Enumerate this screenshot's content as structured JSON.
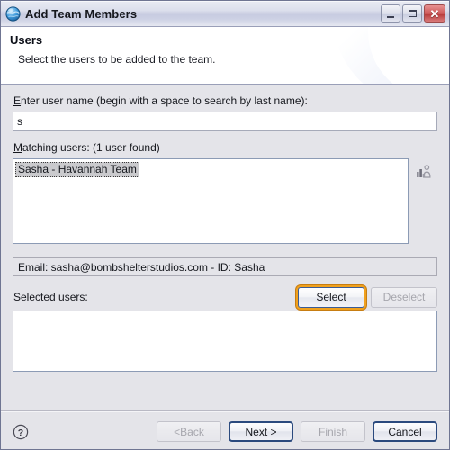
{
  "window": {
    "title": "Add Team Members",
    "icon": "globe-icon",
    "controls": {
      "minimize": "minimize-icon",
      "maximize": "maximize-icon",
      "close": "close-icon",
      "close_glyph": "✕"
    }
  },
  "banner": {
    "title": "Users",
    "subtitle": "Select the users to be added to the team."
  },
  "form": {
    "username_label_pre": "",
    "username_label_mnemonic": "E",
    "username_label_post": "nter user name (begin with a space to search by last name):",
    "username_value": "s",
    "username_placeholder": "",
    "matching_label_mnemonic": "M",
    "matching_label_post": "atching users: (1 user found)",
    "matching_users": [
      "Sasha - Havannah Team"
    ],
    "details_icon": "user-details-icon",
    "status_text": "Email: sasha@bombshelterstudios.com - ID: Sasha",
    "selected_label_pre": "Selected ",
    "selected_label_mnemonic": "u",
    "selected_label_post": "sers:",
    "selected_users": [],
    "select_button": {
      "pre": "",
      "mnemonic": "S",
      "post": "elect",
      "state": "focused-default"
    },
    "deselect_button": {
      "pre": "",
      "mnemonic": "D",
      "post": "eselect",
      "state": "disabled"
    }
  },
  "footer": {
    "help_icon": "help-icon",
    "help_glyph": "?",
    "back_button": {
      "pre": "< ",
      "mnemonic": "B",
      "post": "ack",
      "state": "disabled"
    },
    "next_button": {
      "pre": "",
      "mnemonic": "N",
      "post": "ext >",
      "state": "default"
    },
    "finish_button": {
      "pre": "",
      "mnemonic": "F",
      "post": "inish",
      "state": "disabled"
    },
    "cancel_button": {
      "pre": "",
      "mnemonic": "",
      "post": "Cancel",
      "state": "normal"
    }
  },
  "colors": {
    "window_border": "#6f7592",
    "body_bg": "#e4e4e9",
    "banner_bg": "#ffffff",
    "selection_bg": "#cacacd",
    "focus_ring": "#f0a11e",
    "default_border": "#2b4a7e",
    "close_red": "#c34a4a"
  }
}
